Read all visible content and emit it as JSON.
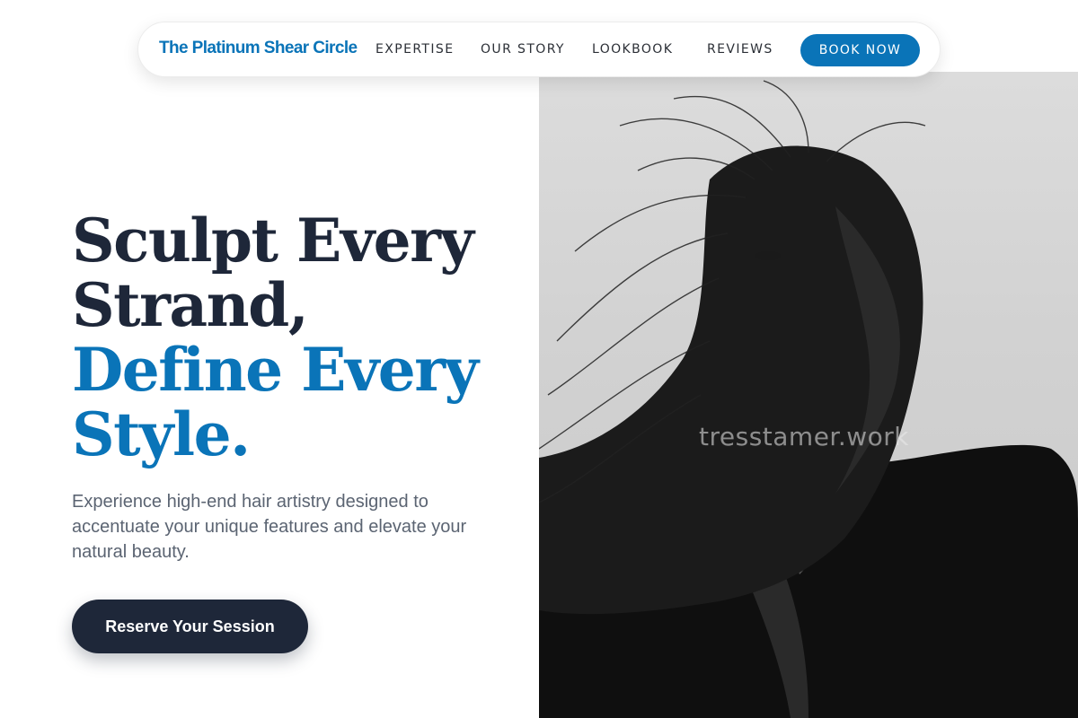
{
  "brand": {
    "name": "The Platinum Shear Circle",
    "color": "#0a74b8"
  },
  "nav": {
    "links": [
      "EXPERTISE",
      "OUR STORY",
      "LOOKBOOK",
      "REVIEWS"
    ],
    "cta_label": "BOOK NOW"
  },
  "hero": {
    "headline_line1": "Sculpt Every",
    "headline_line2": "Strand,",
    "headline_line3": "Define Every",
    "headline_line4": "Style.",
    "subtext": "Experience high-end hair artistry designed to accentuate your unique features and elevate your natural beauty.",
    "cta_label": "Reserve Your Session",
    "image_watermark": "tresstamer.work",
    "colors": {
      "dark": "#1e2739",
      "accent": "#0a74b8"
    }
  }
}
